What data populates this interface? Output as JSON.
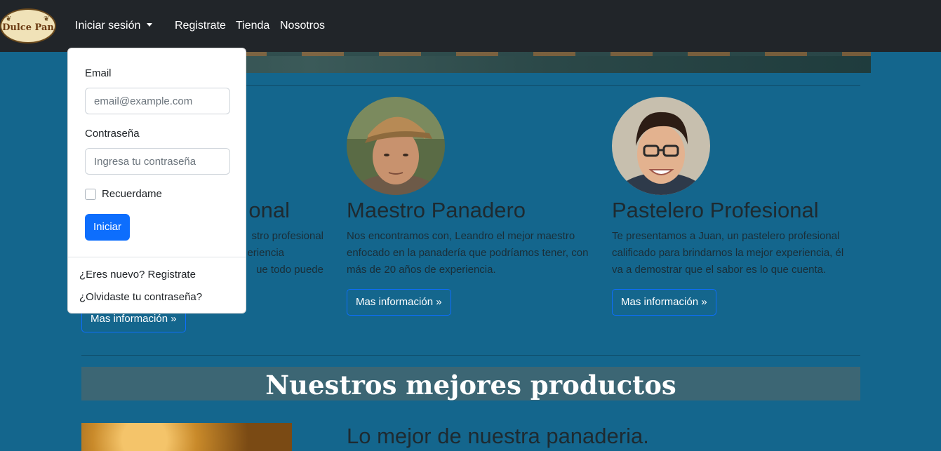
{
  "navbar": {
    "logo_text": "Dulce Pan",
    "links": {
      "login": "Iniciar sesión",
      "register": "Registrate",
      "shop": "Tienda",
      "about": "Nosotros"
    }
  },
  "login_dropdown": {
    "email_label": "Email",
    "email_placeholder": "email@example.com",
    "password_label": "Contraseña",
    "password_placeholder": "Ingresa tu contraseña",
    "remember_label": "Recuerdame",
    "submit_label": "Iniciar",
    "new_user_link": "¿Eres nuevo? Registrate",
    "forgot_link": "¿Olvidaste tu contraseña?"
  },
  "team": [
    {
      "title_visible": "onal",
      "text_lines": [
        "stro profesional",
        "eriencia",
        "ue todo puede"
      ],
      "button": "Mas información »"
    },
    {
      "title": "Maestro Panadero",
      "text": "Nos encontramos con, Leandro el mejor maestro enfocado en la panadería que podríamos tener, con más de 20 años de experiencia.",
      "button": "Mas información »"
    },
    {
      "title": "Pastelero Profesional",
      "text": "Te presentamos a Juan, un pastelero profesional calificado para brindarnos la mejor experiencia, él va a demostrar que el sabor es lo que cuenta.",
      "button": "Mas información »"
    }
  ],
  "products": {
    "heading": "Nuestros mejores productos",
    "feature_title": "Lo mejor de nuestra panaderia."
  },
  "colors": {
    "navbar": "#212529",
    "page_background": "#14668d",
    "primary": "#0d6efd",
    "heading_band": "#3c6674"
  }
}
